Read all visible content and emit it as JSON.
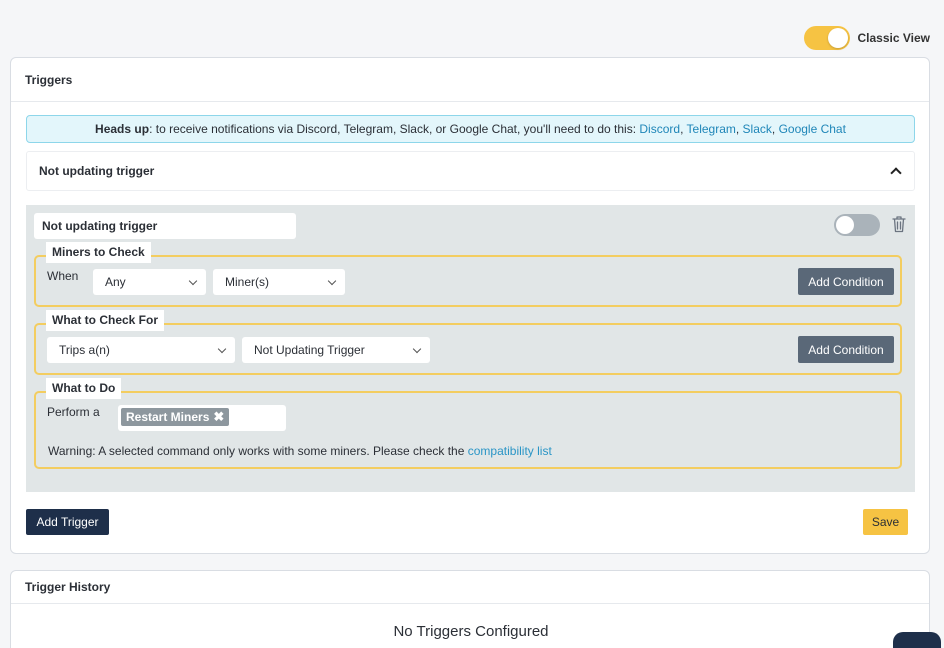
{
  "view_toggle": {
    "label": "Classic View",
    "on": true
  },
  "triggers_card": {
    "title": "Triggers",
    "alert": {
      "bold": "Heads up",
      "text": ": to receive notifications via Discord, Telegram, Slack, or Google Chat, you'll need to do this: ",
      "links": [
        "Discord",
        "Telegram",
        "Slack",
        "Google Chat"
      ],
      "sep": ", "
    },
    "accordion_title": "Not updating trigger",
    "trigger": {
      "name": "Not updating trigger",
      "enabled": false,
      "miners_to_check": {
        "legend": "Miners to Check",
        "prefix": "When",
        "scope": "Any",
        "target": "Miner(s)",
        "add_label": "Add Condition"
      },
      "what_to_check": {
        "legend": "What to Check For",
        "condition": "Trips a(n)",
        "type": "Not Updating Trigger",
        "add_label": "Add Condition"
      },
      "what_to_do": {
        "legend": "What to Do",
        "prefix": "Perform a",
        "action_tag": "Restart Miners",
        "warning_text": "Warning: A selected command only works with some miners. Please check the ",
        "warning_link": "compatibility list"
      }
    },
    "add_trigger_label": "Add Trigger",
    "save_label": "Save"
  },
  "history_card": {
    "title": "Trigger History",
    "empty_message": "No Triggers Configured"
  },
  "colors": {
    "accent": "#f6c343",
    "primary_dark": "#1e2f4a",
    "secondary_button": "#5a6878",
    "link": "#1f86b8",
    "alert_bg": "#e3f6fb"
  }
}
